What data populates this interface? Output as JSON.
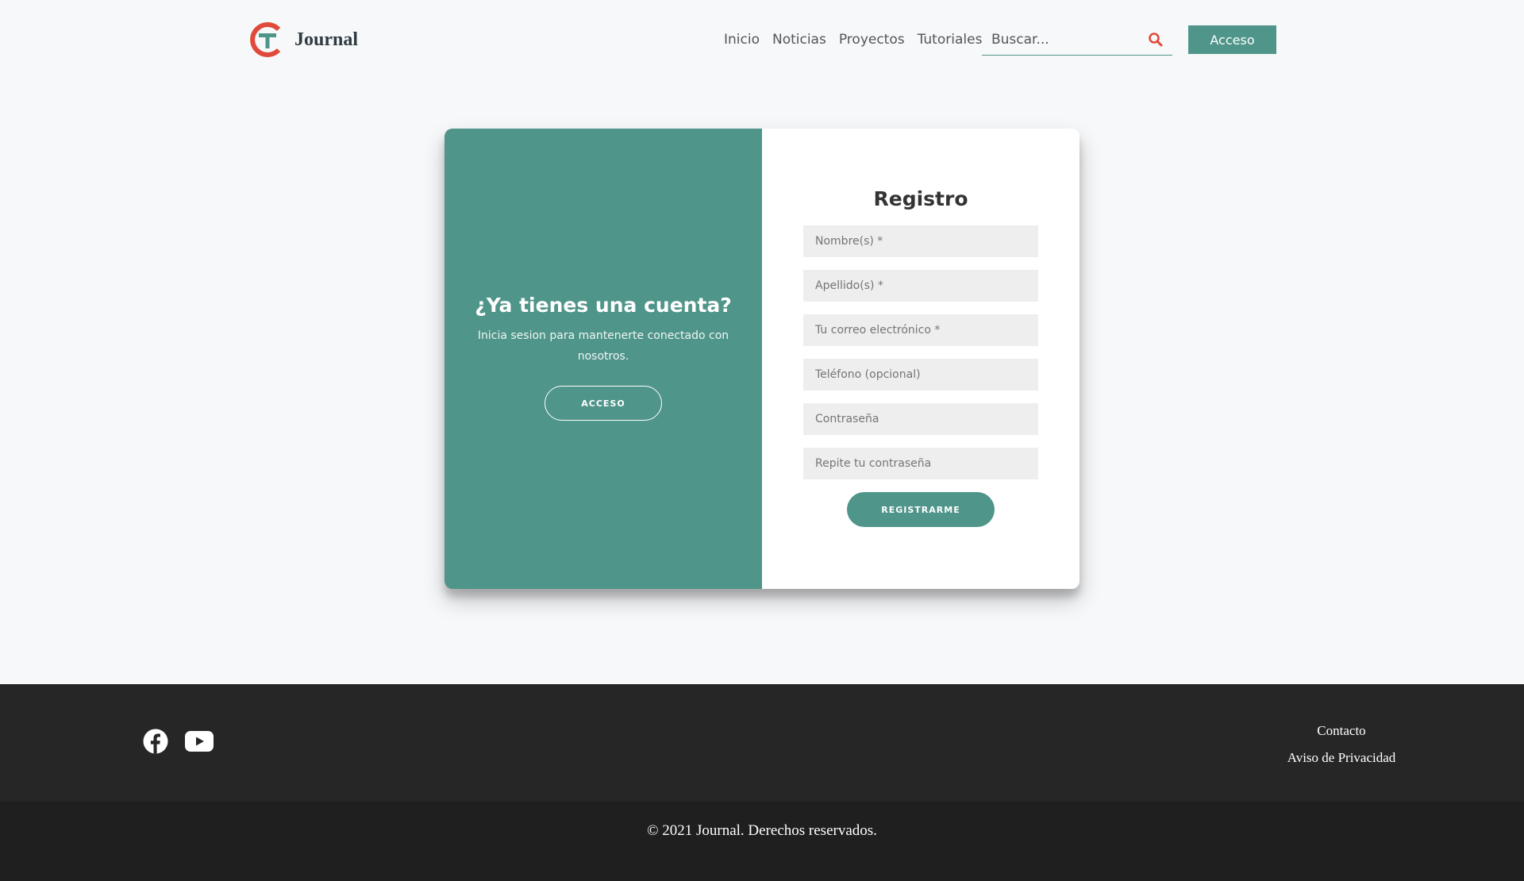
{
  "header": {
    "brand": "Journal",
    "nav": [
      "Inicio",
      "Noticias",
      "Proyectos",
      "Tutoriales"
    ],
    "search_placeholder": "Buscar...",
    "login_label": "Acceso"
  },
  "login_panel": {
    "title": "¿Ya tienes una cuenta?",
    "subtitle": "Inicia sesion para mantenerte conectado con nosotros.",
    "button": "ACCESO"
  },
  "register": {
    "title": "Registro",
    "fields": [
      "Nombre(s) *",
      "Apellido(s) *",
      "Tu correo electrónico *",
      "Teléfono (opcional)",
      "Contraseña",
      "Repite tu contraseña"
    ],
    "submit": "REGISTRARME"
  },
  "footer": {
    "social": [
      "facebook-icon",
      "youtube-icon"
    ],
    "links": [
      "Contacto",
      "Aviso de Privacidad"
    ],
    "copyright": "© 2021 Journal. Derechos reservados."
  },
  "colors": {
    "accent": "#4f9589",
    "logo_red": "#e04a3a",
    "footer_dark": "#262626",
    "footer_darker": "#1f1f1f",
    "page_bg": "#f7f8fa"
  }
}
